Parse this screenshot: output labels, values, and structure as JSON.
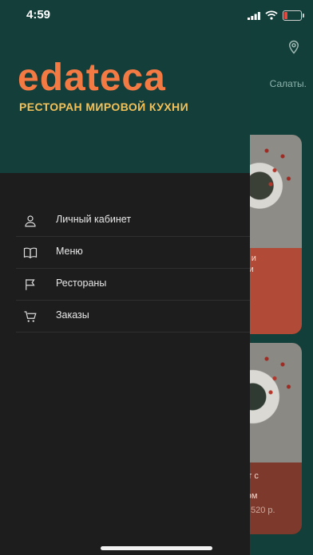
{
  "status_bar": {
    "time": "4:59",
    "battery_level": 0.2,
    "battery_color": "#e5463d"
  },
  "drawer": {
    "logo": {
      "word": "edateca",
      "tagline": "РЕСТОРАН МИРОВОЙ КУХНИ"
    },
    "menu": [
      {
        "label": "Личный кабинет",
        "icon": "user-icon"
      },
      {
        "label": "Меню",
        "icon": "book-icon"
      },
      {
        "label": "Рестораны",
        "icon": "flag-icon"
      },
      {
        "label": "Заказы",
        "icon": "cart-icon"
      }
    ]
  },
  "background": {
    "category": "Салаты.",
    "cards": [
      {
        "name": "ми и\nями",
        "price": ""
      },
      {
        "name": "лат с\nатом",
        "price": "520 р."
      }
    ]
  },
  "colors": {
    "accent": "#f47a44",
    "tagline": "#f4c158",
    "header_bg": "#133e3a",
    "drawer_bg": "#1d1d1d"
  }
}
